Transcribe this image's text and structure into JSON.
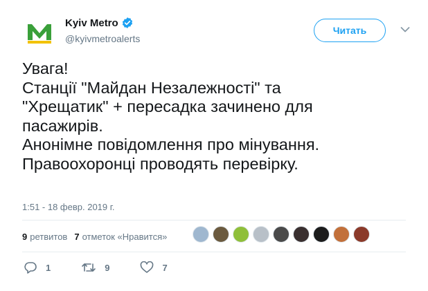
{
  "account": {
    "name": "Kyiv Metro",
    "handle": "@kyivmetroalerts",
    "verified": true,
    "logo_letter": "M",
    "logo_colors": {
      "green": "#3aa03a",
      "yellow": "#f2c200"
    }
  },
  "follow_button": {
    "label": "Читать",
    "color": "#1da1f2"
  },
  "tweet": {
    "lines": [
      "Увага!",
      "Станції \"Майдан Незалежності\" та",
      "\"Хрещатик\" + пересадка зачинено для",
      "пасажирів.",
      "Анонімне повідомлення про мінування.",
      "Правоохоронці проводять перевірку."
    ],
    "timestamp": "1:51 - 18 февр. 2019 г."
  },
  "stats": {
    "retweets_count": "9",
    "retweets_label": "ретвитов",
    "likes_count": "7",
    "likes_label": "отметок «Нравится»"
  },
  "liker_faces": [
    {
      "icon": "liker-avatar-1",
      "color": "#9fb7cf"
    },
    {
      "icon": "liker-avatar-2",
      "color": "#6b5a3f"
    },
    {
      "icon": "liker-avatar-3",
      "color": "#8fbf3a"
    },
    {
      "icon": "liker-avatar-4",
      "color": "#b8c0c8"
    },
    {
      "icon": "liker-avatar-5",
      "color": "#4a4a4a"
    },
    {
      "icon": "liker-avatar-6",
      "color": "#3a3030"
    },
    {
      "icon": "liker-avatar-7",
      "color": "#1c1c1c"
    },
    {
      "icon": "liker-avatar-8",
      "color": "#c2703a"
    },
    {
      "icon": "liker-avatar-9",
      "color": "#8b3a2a"
    }
  ],
  "actions": {
    "reply_count": "1",
    "retweet_count": "9",
    "like_count": "7"
  },
  "icons": {
    "verified": "verified-badge-icon",
    "caret": "chevron-down-icon",
    "reply": "reply-icon",
    "retweet": "retweet-icon",
    "like": "heart-icon"
  }
}
